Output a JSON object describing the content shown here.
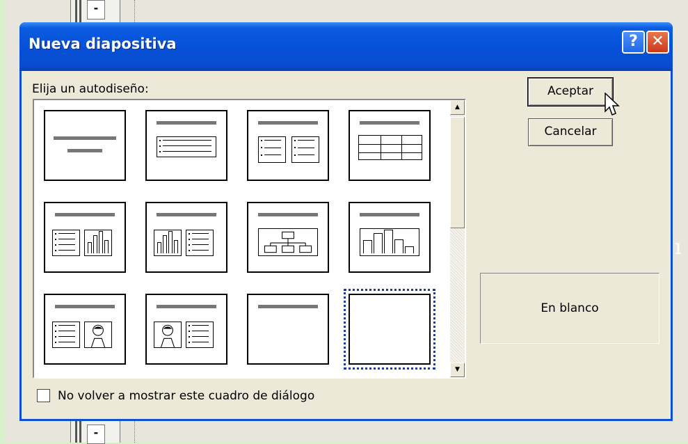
{
  "dialog": {
    "title": "Nueva diapositiva",
    "help_label": "?",
    "close_label": "✕",
    "prompt": "Elija un autodiseño:",
    "ok_label": "Aceptar",
    "cancel_label": "Cancelar",
    "preview_name": "En blanco",
    "checkbox_label": "No volver a mostrar este cuadro de diálogo",
    "checkbox_checked": false,
    "selected_layout": 12
  },
  "layouts": [
    {
      "icon": "title-slide-layout-icon"
    },
    {
      "icon": "bulleted-list-layout-icon"
    },
    {
      "icon": "two-column-text-layout-icon"
    },
    {
      "icon": "table-layout-icon"
    },
    {
      "icon": "text-and-chart-layout-icon"
    },
    {
      "icon": "chart-and-text-layout-icon"
    },
    {
      "icon": "organization-chart-layout-icon"
    },
    {
      "icon": "chart-layout-icon"
    },
    {
      "icon": "text-and-clip-art-layout-icon"
    },
    {
      "icon": "clip-art-and-text-layout-icon"
    },
    {
      "icon": "title-only-layout-icon"
    },
    {
      "icon": "blank-layout-icon"
    }
  ],
  "scrollbar": {
    "up_arrow": "▲",
    "down_arrow": "▼"
  }
}
